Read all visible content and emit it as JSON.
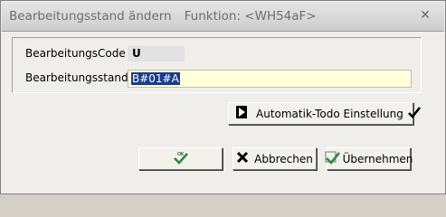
{
  "window": {
    "title": "Bearbeitungsstand ändern",
    "function": "Funktion: <WH54aF>",
    "close_glyph": "✕"
  },
  "form": {
    "code_label": "BearbeitungsCode",
    "code_value": "U",
    "stand_label": "Bearbeitungsstand",
    "stand_value": "B#01#A"
  },
  "buttons": {
    "todo_label": "Automatik-Todo Einstellung",
    "ok_icon_text": "OK",
    "cancel_label": "Abbrechen",
    "apply_label": "Übernehmen"
  },
  "icons": {
    "todo_left": "play-triangle-icon",
    "todo_right": "checkmark-icon",
    "ok": "ok-check-icon",
    "cancel": "x-icon",
    "apply": "apply-check-icon"
  }
}
